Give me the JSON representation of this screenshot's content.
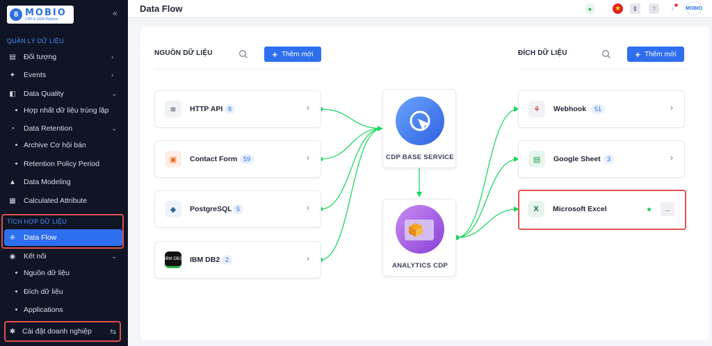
{
  "app": {
    "logo_text": "MOBIO",
    "logo_subtitle": "CDP & CEM Platform"
  },
  "sidebar": {
    "section_data": "QUẢN LÝ DỮ LIỆU",
    "section_integration": "TÍCH HỢP DỮ LIỆU",
    "items": {
      "objects": "Đối tượng",
      "events": "Events",
      "data_quality": "Data Quality",
      "merge_duplicates": "Hợp nhất dữ liệu trùng lặp",
      "data_retention": "Data Retention",
      "archive": "Archive Cơ hội bán",
      "retention_policy": "Retention Policy Period",
      "data_modeling": "Data Modeling",
      "calculated_attribute": "Calculated Attribute",
      "data_flow": "Data Flow",
      "connections": "Kết nối",
      "data_sources": "Nguồn dữ liệu",
      "data_destinations": "Đích dữ liệu",
      "applications": "Applications"
    },
    "footer": "Cài đặt doanh nghiệp"
  },
  "header": {
    "title": "Data Flow"
  },
  "sources": {
    "title": "NGUỒN DỮ LIỆU",
    "add_label": "Thêm mới",
    "items": [
      {
        "name": "HTTP API",
        "count": "8"
      },
      {
        "name": "Contact Form",
        "count": "59"
      },
      {
        "name": "PostgreSQL",
        "count": "5"
      },
      {
        "name": "IBM DB2",
        "count": "2"
      }
    ]
  },
  "destinations": {
    "title": "ĐÍCH DỮ LIỆU",
    "add_label": "Thêm mới",
    "items": [
      {
        "name": "Webhook",
        "count": "51"
      },
      {
        "name": "Google Sheet",
        "count": "3"
      },
      {
        "name": "Microsoft Excel"
      }
    ],
    "more_label": "..."
  },
  "hubs": {
    "cdp_base": "CDP BASE SERVICE",
    "analytics": "ANALYTICS CDP"
  },
  "icons": {
    "ibm_db2": "IBM DB2"
  },
  "colors": {
    "accent": "#2e6ff0",
    "link": "#1ed760",
    "highlight": "#e35050",
    "sidebar_bg": "#0f1524"
  }
}
